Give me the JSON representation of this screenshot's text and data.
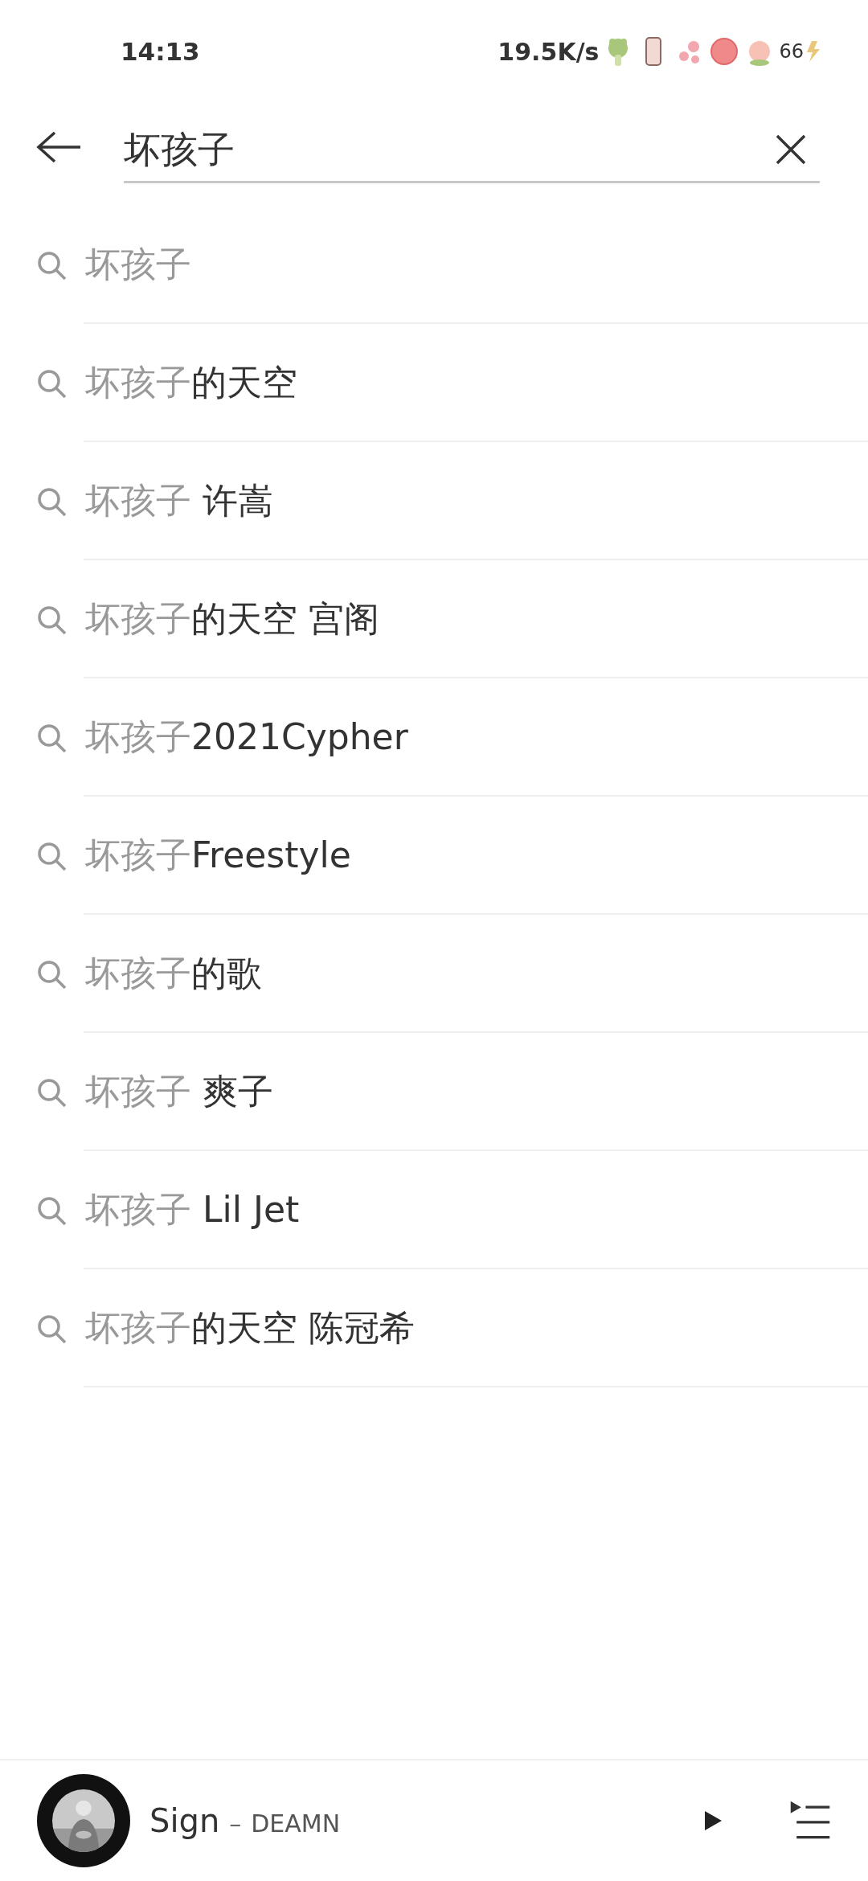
{
  "status_bar": {
    "time": "14:13",
    "speed": "19.5K/s",
    "battery": "66"
  },
  "search": {
    "value": "坏孩子"
  },
  "suggestions": [
    {
      "match": "坏孩子"
    },
    {
      "match": "坏孩子",
      "rest": "的天空"
    },
    {
      "match": "坏孩子",
      "rest": " 许嵩"
    },
    {
      "match": "坏孩子",
      "rest": "的天空 宫阁"
    },
    {
      "match": "坏孩子",
      "rest": "2021Cypher"
    },
    {
      "match": "坏孩子",
      "rest": "Freestyle"
    },
    {
      "match": "坏孩子",
      "rest": "的歌"
    },
    {
      "match": "坏孩子",
      "rest": " 爽子"
    },
    {
      "match": "坏孩子",
      "rest": " Lil Jet"
    },
    {
      "match": "坏孩子",
      "rest": "的天空 陈冠希"
    }
  ],
  "player": {
    "title": "Sign",
    "separator": "–",
    "artist": "DEAMN"
  }
}
